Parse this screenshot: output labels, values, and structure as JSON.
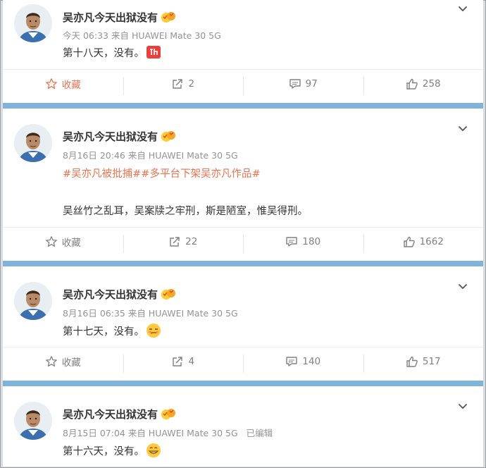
{
  "posts": [
    {
      "name": "吴亦凡今天出狱没有",
      "meta": "今天 06:33 来自 HUAWEI Mate 30 5G",
      "topics": "",
      "text": "第十八天，没有。",
      "emoji": "ding-sticker",
      "fav": "收藏",
      "repost": "2",
      "comment": "97",
      "like": "258"
    },
    {
      "name": "吴亦凡今天出狱没有",
      "meta": "8月16日 20:46 来自 HUAWEI Mate 30 5G",
      "topics": "#吴亦凡被批捕##多平台下架吴亦凡作品#",
      "text": "吴丝竹之乱耳，吴案牍之牢刑，斯是陋室，惟吴得刑。",
      "emoji": "",
      "fav": "收藏",
      "repost": "22",
      "comment": "180",
      "like": "1662"
    },
    {
      "name": "吴亦凡今天出狱没有",
      "meta": "8月16日 06:35 来自 HUAWEI Mate 30 5G",
      "topics": "",
      "text": "第十七天，没有。",
      "emoji": "smirk-emoji",
      "fav": "收藏",
      "repost": "4",
      "comment": "140",
      "like": "517"
    },
    {
      "name": "吴亦凡今天出狱没有",
      "meta": "8月15日 07:04 来自 HUAWEI Mate 30 5G   已编辑",
      "topics": "",
      "text": "第十六天，没有。",
      "emoji": "grin-emoji",
      "fav": "",
      "repost": "",
      "comment": "",
      "like": ""
    }
  ],
  "colors": {
    "accent": "#eb7350",
    "separator": "#7fb3d8",
    "muted": "#939393"
  }
}
